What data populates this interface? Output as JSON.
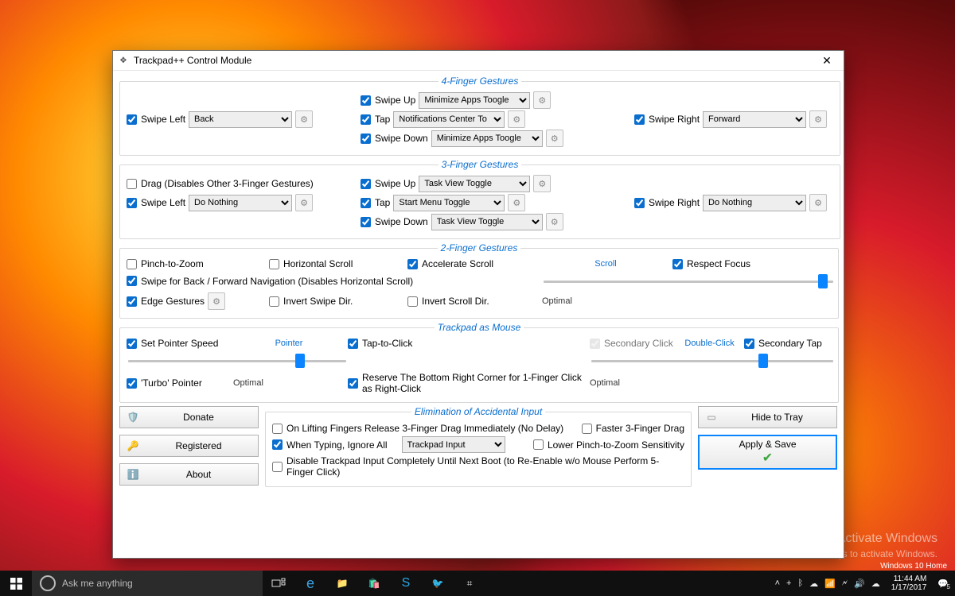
{
  "window": {
    "title": "Trackpad++ Control Module"
  },
  "sections": {
    "four_finger": {
      "legend": "4-Finger Gestures",
      "swipe_left": {
        "label": "Swipe Left",
        "checked": true,
        "value": "Back"
      },
      "swipe_up": {
        "label": "Swipe Up",
        "checked": true,
        "value": "Minimize Apps Toogle"
      },
      "tap": {
        "label": "Tap",
        "checked": true,
        "value": "Notifications Center To"
      },
      "swipe_down": {
        "label": "Swipe Down",
        "checked": true,
        "value": "Minimize Apps Toogle"
      },
      "swipe_right": {
        "label": "Swipe Right",
        "checked": true,
        "value": "Forward"
      }
    },
    "three_finger": {
      "legend": "3-Finger Gestures",
      "drag": {
        "label": "Drag (Disables Other 3-Finger Gestures)",
        "checked": false
      },
      "swipe_left": {
        "label": "Swipe Left",
        "checked": true,
        "value": "Do Nothing"
      },
      "swipe_up": {
        "label": "Swipe Up",
        "checked": true,
        "value": "Task View Toggle"
      },
      "tap": {
        "label": "Tap",
        "checked": true,
        "value": "Start Menu Toggle"
      },
      "swipe_down": {
        "label": "Swipe Down",
        "checked": true,
        "value": "Task View Toggle"
      },
      "swipe_right": {
        "label": "Swipe Right",
        "checked": true,
        "value": "Do Nothing"
      }
    },
    "two_finger": {
      "legend": "2-Finger Gestures",
      "pinch_zoom": {
        "label": "Pinch-to-Zoom",
        "checked": false
      },
      "horizontal_scroll": {
        "label": "Horizontal Scroll",
        "checked": false
      },
      "accelerate_scroll": {
        "label": "Accelerate Scroll",
        "checked": true
      },
      "scroll_label": "Scroll",
      "respect_focus": {
        "label": "Respect Focus",
        "checked": true
      },
      "swipe_nav": {
        "label": "Swipe for Back / Forward Navigation (Disables Horizontal Scroll)",
        "checked": true
      },
      "edge_gestures": {
        "label": "Edge Gestures",
        "checked": true
      },
      "invert_swipe": {
        "label": "Invert Swipe Dir.",
        "checked": false
      },
      "invert_scroll": {
        "label": "Invert Scroll Dir.",
        "checked": false
      },
      "scroll_slider": 98,
      "scroll_optimal": "Optimal"
    },
    "trackpad_mouse": {
      "legend": "Trackpad as Mouse",
      "set_pointer_speed": {
        "label": "Set Pointer Speed",
        "checked": true
      },
      "pointer_label": "Pointer",
      "tap_to_click": {
        "label": "Tap-to-Click",
        "checked": true
      },
      "secondary_click": {
        "label": "Secondary Click",
        "checked": true,
        "disabled": true
      },
      "double_click_label": "Double-Click",
      "secondary_tap": {
        "label": "Secondary Tap",
        "checked": true
      },
      "pointer_slider": 80,
      "dblclick_slider": 72,
      "turbo_pointer": {
        "label": "'Turbo' Pointer",
        "checked": true
      },
      "pointer_optimal": "Optimal",
      "reserve_corner": {
        "label": "Reserve The Bottom Right Corner for 1-Finger Click as Right-Click",
        "checked": true
      },
      "dblclick_optimal": "Optimal"
    },
    "elimination": {
      "legend": "Elimination of Accidental Input",
      "release_drag": {
        "label": "On Lifting Fingers Release 3-Finger Drag Immediately (No Delay)",
        "checked": false
      },
      "faster_drag": {
        "label": "Faster 3-Finger Drag",
        "checked": false
      },
      "when_typing": {
        "label": "When Typing, Ignore All",
        "checked": true,
        "value": "Trackpad Input"
      },
      "lower_pinch": {
        "label": "Lower Pinch-to-Zoom Sensitivity",
        "checked": false
      },
      "disable_until_boot": {
        "label": "Disable Trackpad Input Completely Until Next Boot (to Re-Enable w/o Mouse Perform 5-Finger Click)",
        "checked": false
      }
    }
  },
  "buttons": {
    "donate": "Donate",
    "registered": "Registered",
    "about": "About",
    "hide_to_tray": "Hide to Tray",
    "apply_save": "Apply & Save"
  },
  "watermark": {
    "line1": "Activate Windows",
    "line2": "Go to Settings to activate Windows."
  },
  "edition": "Windows 10 Home",
  "taskbar": {
    "cortana_placeholder": "Ask me anything",
    "time": "11:44 AM",
    "date": "1/17/2017",
    "notification_count": "5"
  }
}
